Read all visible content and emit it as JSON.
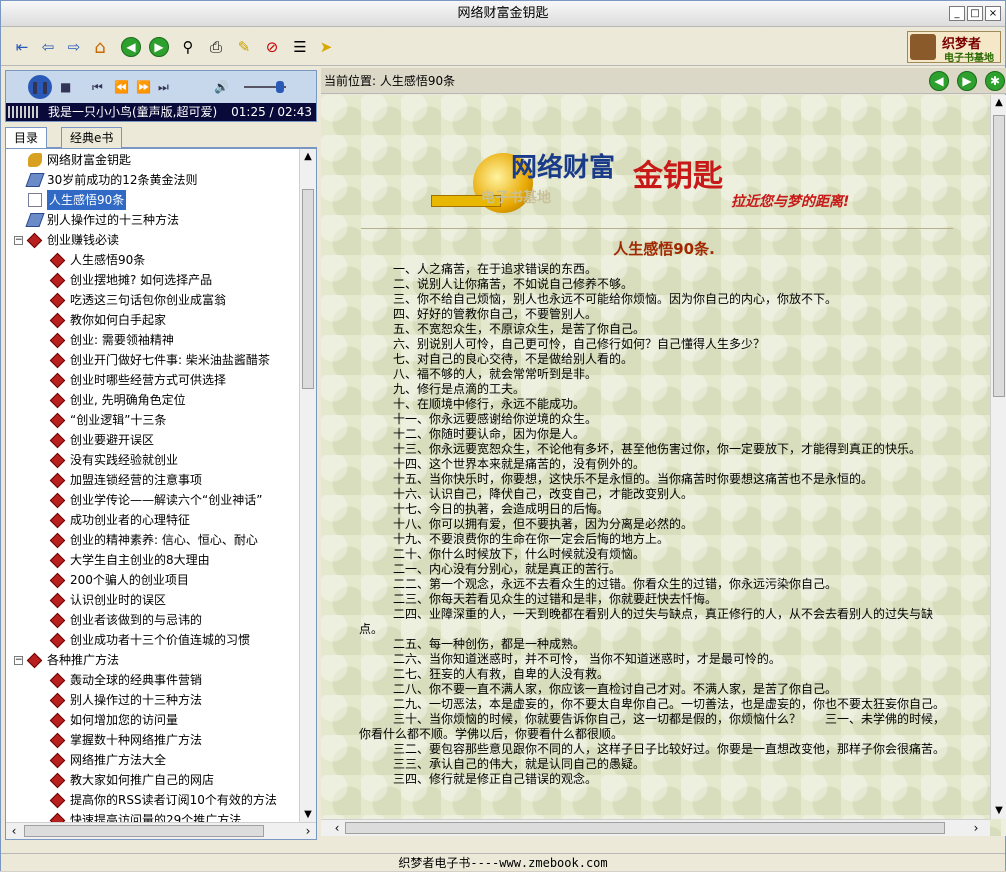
{
  "window": {
    "title": "网络财富金钥匙",
    "min_label": "_",
    "max_label": "□",
    "close_label": "×"
  },
  "toolbar": {
    "icons": [
      "exit-icon",
      "back-arrow-icon",
      "forward-arrow-icon",
      "home-icon",
      "prev-page-icon",
      "next-page-icon",
      "find-icon",
      "print-icon",
      "edit-icon",
      "stop-icon",
      "properties-icon",
      "pointer-icon"
    ],
    "brand_line1": "织梦者",
    "brand_line2": "电子书基地"
  },
  "player": {
    "now_playing": "我是一只小小鸟(童声版,超可爱)",
    "time": "01:25 / 02:43",
    "volume_percent": 80
  },
  "tabs": [
    {
      "label": "目录",
      "active": true
    },
    {
      "label": "经典e书",
      "active": false
    }
  ],
  "tree": [
    {
      "label": "网络财富金钥匙",
      "icon": "key",
      "level": 0
    },
    {
      "label": "30岁前成功的12条黄金法则",
      "icon": "book",
      "level": 0
    },
    {
      "label": "人生感悟90条",
      "icon": "doc",
      "level": 0,
      "selected": true
    },
    {
      "label": "别人操作过的十三种方法",
      "icon": "book",
      "level": 0
    },
    {
      "label": "创业赚钱必读",
      "icon": "folder",
      "level": 0,
      "expander": "−"
    },
    {
      "label": "人生感悟90条",
      "icon": "red",
      "level": 1
    },
    {
      "label": "创业摆地摊? 如何选择产品",
      "icon": "red",
      "level": 1
    },
    {
      "label": "吃透这三句话包你创业成富翁",
      "icon": "red",
      "level": 1
    },
    {
      "label": "教你如何白手起家",
      "icon": "red",
      "level": 1
    },
    {
      "label": "创业: 需要领袖精神",
      "icon": "red",
      "level": 1
    },
    {
      "label": "创业开门做好七件事: 柴米油盐酱醋茶",
      "icon": "red",
      "level": 1
    },
    {
      "label": "创业时哪些经营方式可供选择",
      "icon": "red",
      "level": 1
    },
    {
      "label": "创业, 先明确角色定位",
      "icon": "red",
      "level": 1
    },
    {
      "label": "“创业逻辑”十三条",
      "icon": "red",
      "level": 1
    },
    {
      "label": "创业要避开误区",
      "icon": "red",
      "level": 1
    },
    {
      "label": "没有实践经验就创业",
      "icon": "red",
      "level": 1
    },
    {
      "label": "加盟连锁经营的注意事项",
      "icon": "red",
      "level": 1
    },
    {
      "label": "创业学传论——解读六个“创业神话”",
      "icon": "red",
      "level": 1
    },
    {
      "label": "成功创业者的心理特征",
      "icon": "red",
      "level": 1
    },
    {
      "label": "创业的精神素养: 信心、恒心、耐心",
      "icon": "red",
      "level": 1
    },
    {
      "label": "大学生自主创业的8大理由",
      "icon": "red",
      "level": 1
    },
    {
      "label": "200个骗人的创业项目",
      "icon": "red",
      "level": 1
    },
    {
      "label": "认识创业时的误区",
      "icon": "red",
      "level": 1
    },
    {
      "label": "创业者该做到的与忌讳的",
      "icon": "red",
      "level": 1
    },
    {
      "label": "创业成功者十三个价值连城的习惯",
      "icon": "red",
      "level": 1
    },
    {
      "label": "各种推广方法",
      "icon": "folder",
      "level": 0,
      "expander": "−"
    },
    {
      "label": "轰动全球的经典事件营销",
      "icon": "red",
      "level": 1
    },
    {
      "label": "别人操作过的十三种方法",
      "icon": "red",
      "level": 1
    },
    {
      "label": "如何增加您的访问量",
      "icon": "red",
      "level": 1
    },
    {
      "label": "掌握数十种网络推广方法",
      "icon": "red",
      "level": 1
    },
    {
      "label": "网络推广方法大全",
      "icon": "red",
      "level": 1
    },
    {
      "label": "教大家如何推广自己的网店",
      "icon": "red",
      "level": 1
    },
    {
      "label": "提高你的RSS读者订阅10个有效的方法",
      "icon": "red",
      "level": 1
    },
    {
      "label": "快速提高访问量的29个推广方法",
      "icon": "red",
      "level": 1
    }
  ],
  "location": {
    "label": "当前位置:",
    "value": "人生感悟90条"
  },
  "banner": {
    "title1": "网络财富",
    "title2": "金钥匙",
    "slogan": "拉近您与梦的距离!",
    "watermark": "电子书基地"
  },
  "article": {
    "title": "人生感悟90条.",
    "paragraphs": [
      "一、人之痛苦，在于追求错误的东西。",
      "二、说别人让你痛苦，不如说自己修养不够。",
      "三、你不给自己烦恼，别人也永远不可能给你烦恼。因为你自己的内心，你放不下。",
      "四、好好的管教你自己，不要管别人。",
      "五、不宽恕众生，不原谅众生，是苦了你自己。",
      "六、别说别人可怜，自己更可怜，自己修行如何？自己懂得人生多少？",
      "七、对自己的良心交待，不是做给别人看的。",
      "八、福不够的人，就会常常听到是非。",
      "九、修行是点滴的工夫。",
      "十、在顺境中修行，永远不能成功。",
      "十一、你永远要感谢给你逆境的众生。",
      "十二、你随时要认命，因为你是人。",
      "十三、你永远要宽恕众生，不论他有多坏，甚至他伤害过你，你一定要放下，才能得到真正的快乐。",
      "十四、这个世界本来就是痛苦的，没有例外的。",
      "十五、当你快乐时，你要想，这快乐不是永恒的。当你痛苦时你要想这痛苦也不是永恒的。",
      "十六、认识自己，降伏自己，改变自己，才能改变别人。",
      "十七、今日的执著，会造成明日的后悔。",
      "十八、你可以拥有爱，但不要执著，因为分离是必然的。",
      "十九、不要浪费你的生命在你一定会后悔的地方上。",
      "二十、你什么时候放下，什么时候就没有烦恼。",
      "二一、内心没有分别心，就是真正的苦行。",
      "二二、第一个观念，永远不去看众生的过错。你看众生的过错，你永远污染你自己。",
      "二三、你每天若看见众生的过错和是非，你就要赶快去忏悔。",
      "二四、业障深重的人，一天到晚都在看别人的过失与缺点，真正修行的人，从不会去看别人的过失与缺点。",
      "二五、每一种创伤，都是一种成熟。",
      "二六、当你知道迷惑时，并不可怜， 当你不知道迷惑时，才是最可怜的。",
      "二七、狂妄的人有救，自卑的人没有救。",
      "二八、你不要一直不满人家，你应该一直检讨自己才对。不满人家，是苦了你自己。",
      "二九、一切恶法，本是虚妄的，你不要太自卑你自己。一切善法，也是虚妄的，你也不要太狂妄你自己。",
      "三十、当你烦恼的时候，你就要告诉你自己，这一切都是假的，你烦恼什么？　　三一、未学佛的时候，你看什么都不顺。学佛以后，你要看什么都很顺。",
      "三二、要包容那些意见跟你不同的人，这样子日子比较好过。你要是一直想改变他，那样子你会很痛苦。",
      "三三、承认自己的伟大，就是认同自己的愚疑。",
      "三四、修行就是修正自己错误的观念。"
    ]
  },
  "status": {
    "text": "织梦者电子书----www.zmebook.com"
  }
}
